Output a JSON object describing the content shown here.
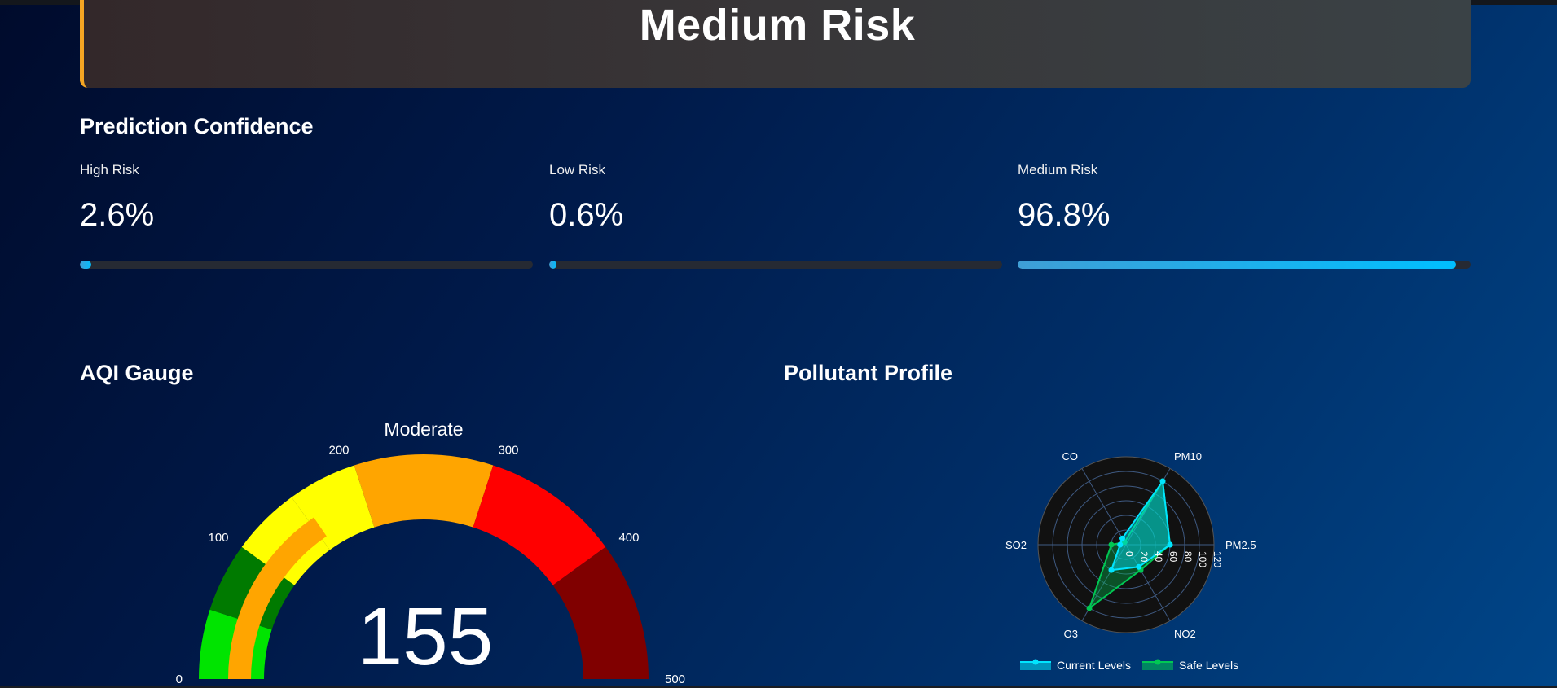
{
  "banner": {
    "title": "Medium Risk",
    "accent": "#f5a623"
  },
  "confidence": {
    "title": "Prediction Confidence",
    "items": [
      {
        "label": "High Risk",
        "value": "2.6%",
        "fraction": 0.026
      },
      {
        "label": "Low Risk",
        "value": "0.6%",
        "fraction": 0.006
      },
      {
        "label": "Medium Risk",
        "value": "96.8%",
        "fraction": 0.968
      }
    ],
    "bar_color": "#00bfff"
  },
  "gauge": {
    "title": "AQI Gauge",
    "label": "Moderate",
    "value": "155",
    "value_num": 155,
    "min": 0,
    "max": 500,
    "ticks": [
      "0",
      "100",
      "200",
      "300",
      "400",
      "500"
    ],
    "tick_values": [
      0,
      100,
      200,
      300,
      400,
      500
    ],
    "bands": [
      {
        "from": 0,
        "to": 50,
        "color": "#00e400"
      },
      {
        "from": 50,
        "to": 100,
        "color": "#007a00"
      },
      {
        "from": 100,
        "to": 150,
        "color": "#ffff00"
      },
      {
        "from": 150,
        "to": 200,
        "color": "#ffff00"
      },
      {
        "from": 200,
        "to": 300,
        "color": "#ffa500"
      },
      {
        "from": 300,
        "to": 400,
        "color": "#ff0000"
      },
      {
        "from": 400,
        "to": 500,
        "color": "#800000"
      }
    ],
    "bar_color": "#ffa500"
  },
  "pollutant": {
    "title": "Pollutant Profile",
    "chart_data": {
      "type": "radar",
      "axes": [
        "PM2.5",
        "PM10",
        "CO",
        "SO2",
        "O3",
        "NO2"
      ],
      "radial_ticks": [
        "0",
        "20",
        "40",
        "60",
        "80",
        "100",
        "120"
      ],
      "radial_values": [
        0,
        20,
        40,
        60,
        80,
        100,
        120
      ],
      "range": [
        0,
        120
      ],
      "series": [
        {
          "name": "Current Levels",
          "values": [
            60,
            100,
            10,
            8,
            40,
            35
          ],
          "color": "#00e5ff"
        },
        {
          "name": "Safe Levels",
          "values": [
            60,
            100,
            4,
            20,
            100,
            40
          ],
          "color": "#00c853"
        }
      ],
      "legend": "bottom"
    }
  }
}
